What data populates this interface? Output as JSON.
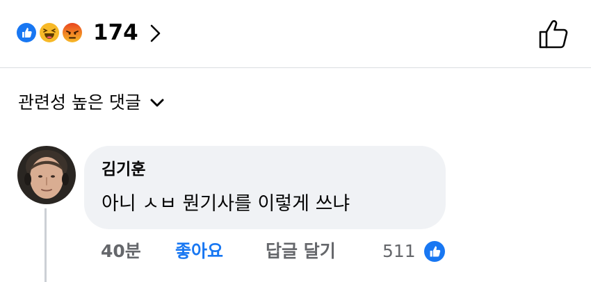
{
  "reactions": {
    "icons": [
      "like-icon",
      "haha-icon",
      "angry-icon"
    ],
    "count": "174"
  },
  "sort": {
    "label": "관련성 높은 댓글"
  },
  "comment": {
    "author": "김기훈",
    "text": "아니 ㅅㅂ 뭔기사를 이렇게 쓰냐",
    "time": "40분",
    "like_label": "좋아요",
    "reply_label": "답글 달기",
    "like_count": "511"
  },
  "colors": {
    "accent": "#1877f2",
    "bubble": "#f0f2f5",
    "secondary_text": "#65676b",
    "divider": "#dadde1"
  }
}
